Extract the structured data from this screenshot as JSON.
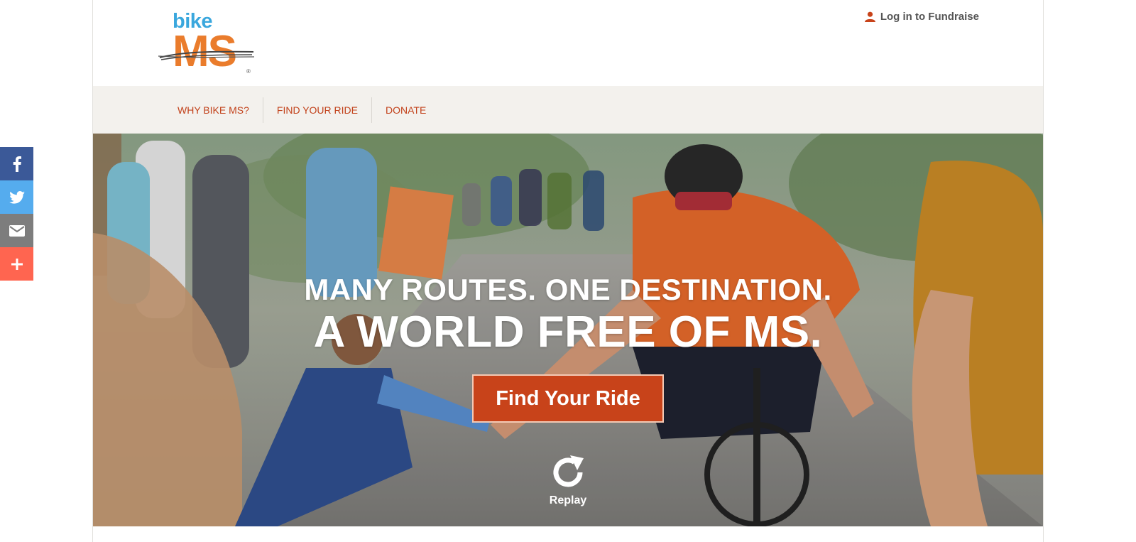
{
  "logo": {
    "top_text": "bike",
    "main_text": "MS",
    "reg_mark": "®",
    "colors": {
      "bike": "#3aa7dd",
      "ms": "#ea7c2c"
    }
  },
  "header": {
    "login_label": "Log in to Fundraise",
    "login_icon": "user-icon"
  },
  "nav": {
    "items": [
      {
        "label": "WHY BIKE MS?"
      },
      {
        "label": "FIND YOUR RIDE"
      },
      {
        "label": "DONATE"
      }
    ],
    "color": "#c2421b"
  },
  "hero": {
    "headline_line1": "MANY ROUTES. ONE DESTINATION.",
    "headline_line2": "A WORLD FREE OF MS.",
    "cta_label": "Find Your Ride",
    "replay_label": "Replay",
    "replay_icon": "replay-icon",
    "cta_color": "#c8431a"
  },
  "share": {
    "items": [
      {
        "icon": "facebook-icon",
        "color": "#3b5998"
      },
      {
        "icon": "twitter-icon",
        "color": "#55acee"
      },
      {
        "icon": "email-icon",
        "color": "#7d7d7d"
      },
      {
        "icon": "plus-icon",
        "color": "#ff6550"
      }
    ]
  }
}
